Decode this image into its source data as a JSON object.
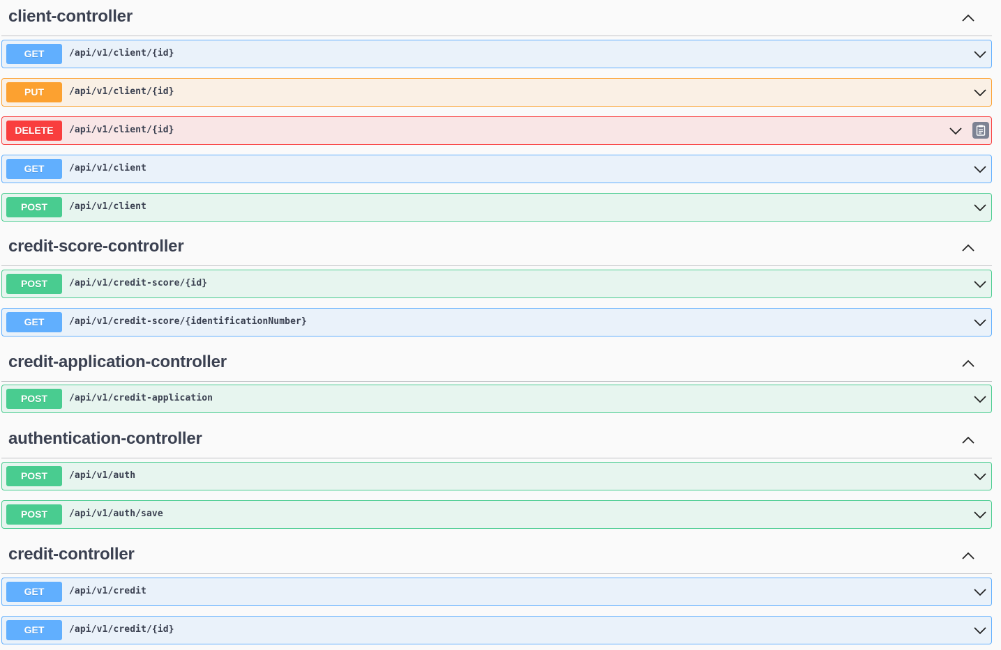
{
  "colors": {
    "get": "#61affe",
    "put": "#fca130",
    "delete": "#f93e3e",
    "post": "#49cc90",
    "text": "#3b4151"
  },
  "icons": {
    "collapse": "chevron-up-icon",
    "expand": "chevron-down-icon",
    "copy": "clipboard-icon"
  },
  "sections": [
    {
      "name": "client-controller",
      "operations": [
        {
          "method": "GET",
          "path": "/api/v1/client/{id}"
        },
        {
          "method": "PUT",
          "path": "/api/v1/client/{id}"
        },
        {
          "method": "DELETE",
          "path": "/api/v1/client/{id}"
        },
        {
          "method": "GET",
          "path": "/api/v1/client"
        },
        {
          "method": "POST",
          "path": "/api/v1/client"
        }
      ]
    },
    {
      "name": "credit-score-controller",
      "operations": [
        {
          "method": "POST",
          "path": "/api/v1/credit-score/{id}"
        },
        {
          "method": "GET",
          "path": "/api/v1/credit-score/{identificationNumber}"
        }
      ]
    },
    {
      "name": "credit-application-controller",
      "operations": [
        {
          "method": "POST",
          "path": "/api/v1/credit-application"
        }
      ]
    },
    {
      "name": "authentication-controller",
      "operations": [
        {
          "method": "POST",
          "path": "/api/v1/auth"
        },
        {
          "method": "POST",
          "path": "/api/v1/auth/save"
        }
      ]
    },
    {
      "name": "credit-controller",
      "operations": [
        {
          "method": "GET",
          "path": "/api/v1/credit"
        },
        {
          "method": "GET",
          "path": "/api/v1/credit/{id}"
        }
      ]
    }
  ]
}
